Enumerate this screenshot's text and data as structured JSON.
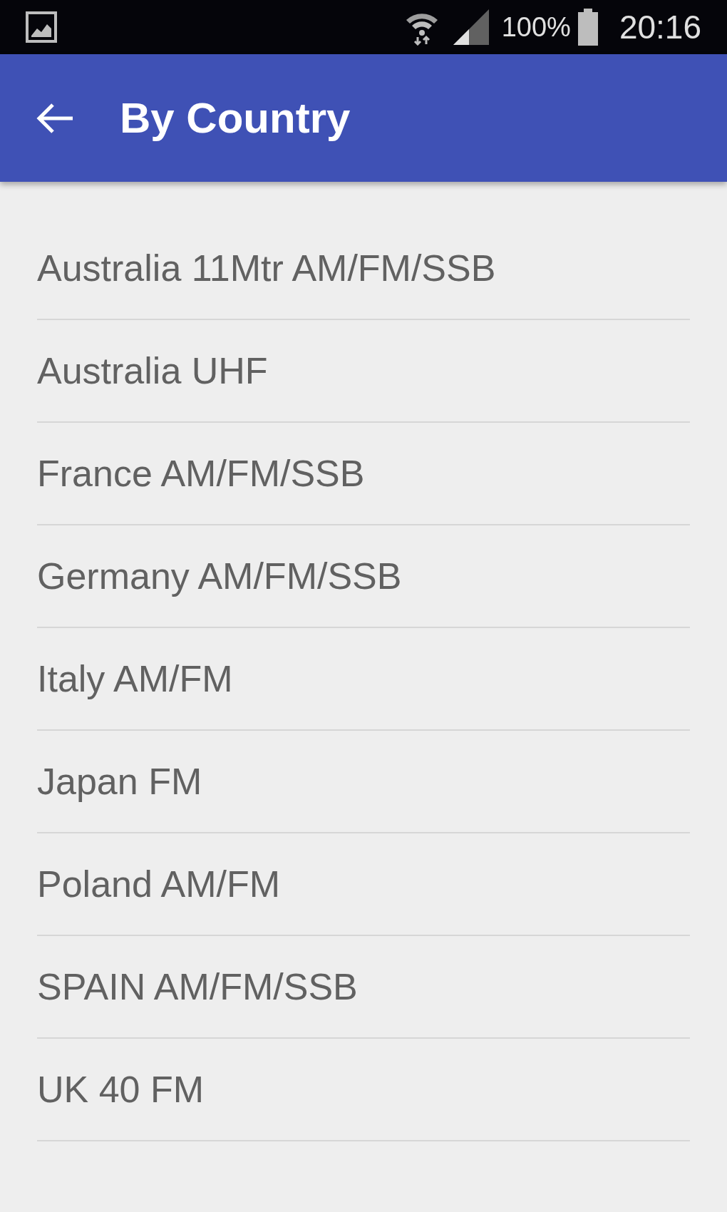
{
  "status_bar": {
    "battery": "100%",
    "time": "20:16"
  },
  "app_bar": {
    "title": "By Country"
  },
  "items": [
    {
      "label": "Australia 11Mtr AM/FM/SSB"
    },
    {
      "label": "Australia UHF"
    },
    {
      "label": "France AM/FM/SSB"
    },
    {
      "label": "Germany AM/FM/SSB"
    },
    {
      "label": "Italy AM/FM"
    },
    {
      "label": "Japan FM"
    },
    {
      "label": "Poland AM/FM"
    },
    {
      "label": "SPAIN AM/FM/SSB"
    },
    {
      "label": "UK 40 FM"
    }
  ]
}
